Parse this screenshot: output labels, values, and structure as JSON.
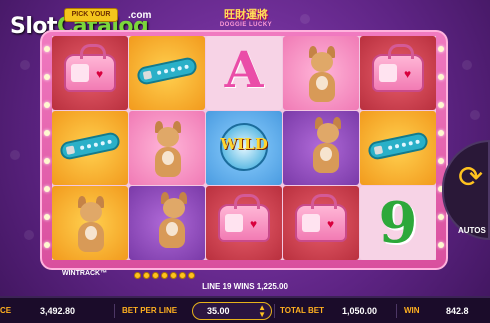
{
  "branding": {
    "site_logo_part1": "Slot",
    "site_logo_part2": "Catalog",
    "site_logo_suffix": ".com",
    "game_badge": "PICK YOUR",
    "game_title_cn": "旺財運將",
    "game_title_en": "DOGGIE LUCKY"
  },
  "colors": {
    "background": "#6a2c8e",
    "frame": "#e85ea8",
    "accent": "#ffb020",
    "nine_green": "#2da83a"
  },
  "reels": [
    [
      {
        "symbol": "pink-bag-icon",
        "bg": "red"
      },
      {
        "symbol": "blue-collar-icon",
        "bg": "orange"
      },
      {
        "symbol": "chihuahua-icon",
        "bg": "orange"
      }
    ],
    [
      {
        "symbol": "blue-collar-icon",
        "bg": "orange"
      },
      {
        "symbol": "chihuahua-icon",
        "bg": "pink"
      },
      {
        "symbol": "chihuahua-jumping-icon",
        "bg": "purple"
      }
    ],
    [
      {
        "symbol": "letter-a",
        "bg": "plain",
        "text": "A"
      },
      {
        "symbol": "wild-icon",
        "bg": "blue",
        "text": "WILD"
      },
      {
        "symbol": "pink-bag-icon",
        "bg": "red"
      }
    ],
    [
      {
        "symbol": "chihuahua-icon",
        "bg": "pink"
      },
      {
        "symbol": "chihuahua-jumping-icon",
        "bg": "purple"
      },
      {
        "symbol": "pink-bag-icon",
        "bg": "red"
      }
    ],
    [
      {
        "symbol": "pink-bag-icon",
        "bg": "red"
      },
      {
        "symbol": "blue-collar-icon",
        "bg": "orange"
      },
      {
        "symbol": "nine",
        "bg": "plain",
        "text": "9"
      }
    ]
  ],
  "wintrack": {
    "label": "WINTRACK",
    "tm": "™",
    "coins": 7
  },
  "win_message": "LINE 19 WINS 1,225.00",
  "autospin": {
    "label": "AUTOS"
  },
  "bottom_bar": {
    "balance_label": "CE",
    "balance_value": "3,492.80",
    "bet_per_line_label": "BET PER LINE",
    "bet_per_line_value": "35.00",
    "total_bet_label": "TOTAL BET",
    "total_bet_value": "1,050.00",
    "win_label": "WIN",
    "win_value": "842.8"
  }
}
